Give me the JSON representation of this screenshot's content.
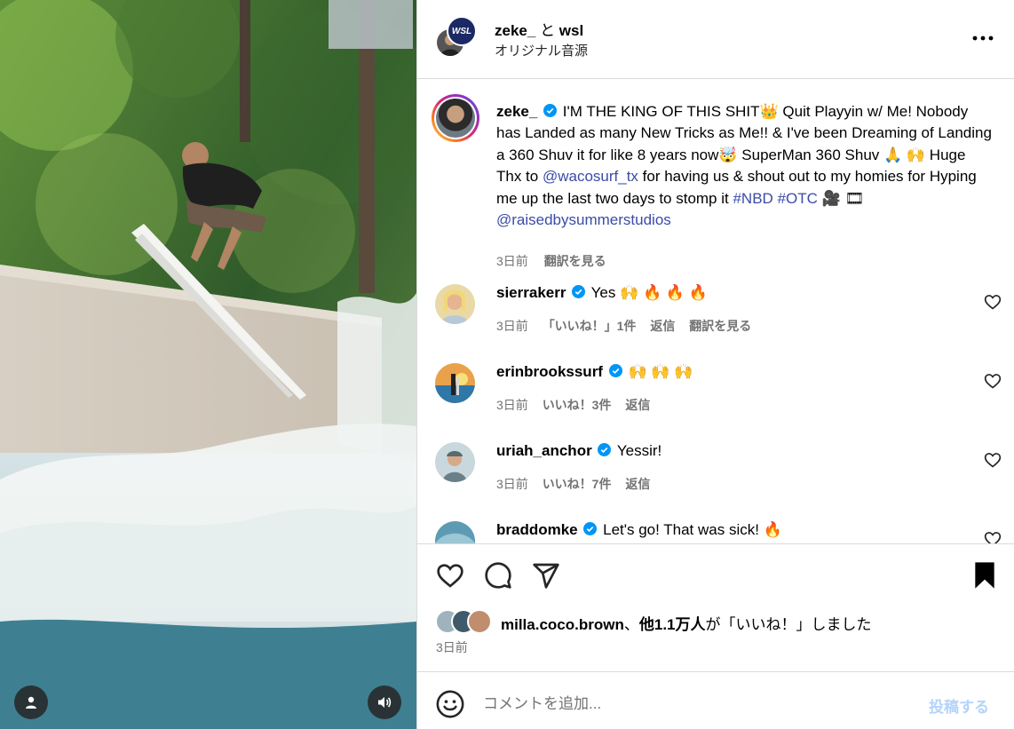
{
  "post": {
    "author": "zeke_",
    "header_joiner": "と",
    "collaborator": "wsl",
    "collab_badge": "WSL",
    "audio": "オリジナル音源"
  },
  "caption": {
    "username": "zeke_",
    "t1": "I'M THE KING OF THIS SHIT👑 Quit Playyin w/ Me! Nobody has Landed as many New Tricks as Me!! & I've been Dreaming of Landing a 360 Shuv it for like 8 years now🤯 SuperMan 360 Shuv 🙏 🙌 Huge Thx to ",
    "mention1": "@wacosurf_tx",
    "t2": " for having us & shout out to my homies for Hyping me up the last two days to stomp it ",
    "tag1": "#NBD",
    "tag2": "#OTC",
    "t3": " 🎥 🎞 ",
    "mention2": "@raisedbysummerstudios",
    "time": "3日前",
    "translate": "翻訳を見る"
  },
  "comments": [
    {
      "username": "sierrakerr",
      "text": "Yes 🙌 🔥 🔥 🔥",
      "time": "3日前",
      "likes": "「いいね！」1件",
      "reply": "返信",
      "translate": "翻訳を見る"
    },
    {
      "username": "erinbrookssurf",
      "text": "🙌 🙌 🙌",
      "time": "3日前",
      "likes": "いいね！3件",
      "reply": "返信"
    },
    {
      "username": "uriah_anchor",
      "text": "Yessir!",
      "time": "3日前",
      "likes": "いいね！7件",
      "reply": "返信"
    },
    {
      "username": "braddomke",
      "text": "Let's go! That was sick! 🔥"
    }
  ],
  "likes": {
    "user": "milla.coco.brown",
    "sep": "、",
    "count": "他1.1万人",
    "suffix": "が「いいね！」しました"
  },
  "post_time": "3日前",
  "comment_box": {
    "placeholder": "コメントを追加...",
    "post_label": "投稿する"
  },
  "icons": {
    "more": "more-icon",
    "like": "heart-icon",
    "comment": "comment-icon",
    "share": "share-icon",
    "save": "bookmark-icon",
    "emoji": "emoji-icon",
    "sound": "sound-icon",
    "user": "user-icon"
  }
}
